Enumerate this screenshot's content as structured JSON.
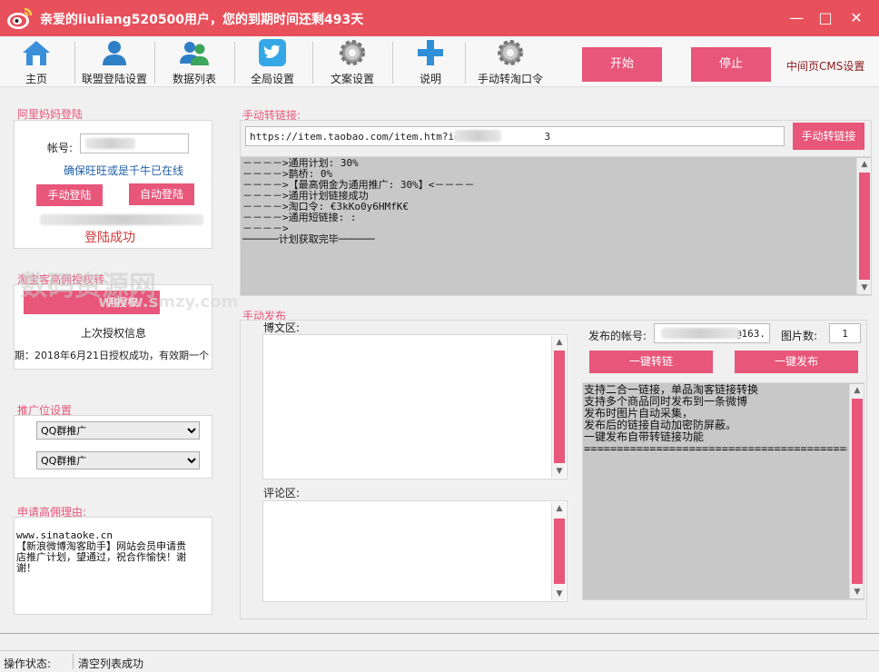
{
  "titlebar": {
    "title": "亲爱的liuliang520500用户，您的到期时间还剩493天",
    "minimize": "—",
    "maximize": "□",
    "close": "✕"
  },
  "toolbar": {
    "items": [
      {
        "label": "主页",
        "icon": "home-icon"
      },
      {
        "label": "联盟登陆设置",
        "icon": "user-icon"
      },
      {
        "label": "数据列表",
        "icon": "users-icon"
      },
      {
        "label": "全局设置",
        "icon": "twitter-bird-icon"
      },
      {
        "label": "文案设置",
        "icon": "gear-icon"
      },
      {
        "label": "说明",
        "icon": "plus-icon"
      },
      {
        "label": "手动转淘口令",
        "icon": "gear-icon"
      }
    ],
    "start": "开始",
    "stop": "停止",
    "cms": "中间页CMS设置"
  },
  "alimama": {
    "title": "阿里妈妈登陆",
    "account_label": "帐号:",
    "hint": "确保旺旺或是千牛已在线",
    "manual_login": "手动登陆",
    "auto_login": "自动登陆",
    "status": "登陆成功"
  },
  "auth": {
    "title": "淘宝客高佣授权转",
    "button": "佣授权",
    "last_info_label": "上次授权信息",
    "last_info": "期：2018年6月21日授权成功，有效期一个"
  },
  "promo": {
    "title": "推广位设置",
    "option1": "QQ群推广",
    "option2": "QQ群推广"
  },
  "apply": {
    "title": "申请高佣理由:",
    "text": "www.sinataoke.cn\n【新浪微博淘客助手】网站会员申请贵\n店推广计划，望通过，祝合作愉快！谢\n谢！"
  },
  "manual_link": {
    "title": "手动转链接:",
    "url": "https://item.taobao.com/item.htm?id=5            3",
    "button": "手动转链接",
    "log": "－－－－>通用计划: 30%\n－－－－>鹊桥: 0%\n－－－－>【最高佣金为通用推广: 30%】<－－－－\n－－－－>通用计划链接成功\n－－－－>淘口令: €3kKo0y6HMfK€\n－－－－>通用短链接: :\n－－－－>\n──────计划获取完毕──────"
  },
  "publish": {
    "title": "手动发布",
    "blog_label": "博文区:",
    "comment_label": "评论区:",
    "account_label": "发布的帐号:",
    "account_value": "@163.",
    "pic_label": "图片数:",
    "pic_value": "1",
    "convert_btn": "一键转链",
    "publish_btn": "一键发布",
    "info": "支持二合一链接，单品淘客链接转换\n支持多个商品同时发布到一条微博\n发布时图片自动采集，\n发布后的链接自动加密防屏蔽。\n一键发布自带转链接功能\n================================================"
  },
  "watermark": {
    "brand": "数码资源网",
    "site": "www.smzy.com"
  },
  "status": {
    "label": "操作状态:",
    "value": "清空列表成功"
  },
  "colors": {
    "accent": "#e8567a",
    "titlebar": "#e8505b"
  }
}
